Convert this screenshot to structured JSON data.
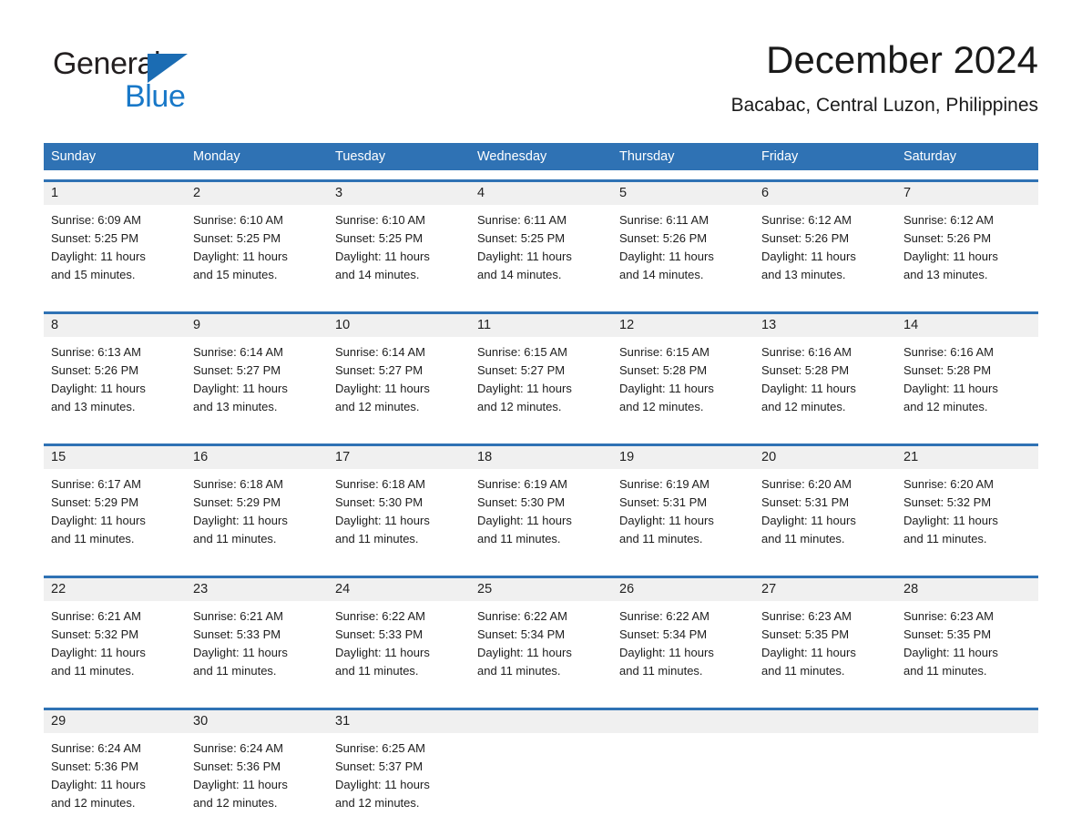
{
  "brand": {
    "word1": "General",
    "word2": "Blue",
    "triangle_icon": "triangle-logo-icon",
    "blue": "#1878c8",
    "dark_blue": "#1b6cb3"
  },
  "header": {
    "title": "December 2024",
    "location": "Bacabac, Central Luzon, Philippines"
  },
  "theme": {
    "header_band": "#2f72b4",
    "daynum_band": "#f0f0f0",
    "text": "#1d1d1d"
  },
  "weekdays": [
    "Sunday",
    "Monday",
    "Tuesday",
    "Wednesday",
    "Thursday",
    "Friday",
    "Saturday"
  ],
  "labels": {
    "sunrise_prefix": "Sunrise:",
    "sunset_prefix": "Sunset:",
    "daylight_prefix": "Daylight:"
  },
  "weeks": [
    {
      "days": [
        {
          "num": "1",
          "l1": "Sunrise: 6:09 AM",
          "l2": "Sunset: 5:25 PM",
          "l3": "Daylight: 11 hours",
          "l4": "and 15 minutes."
        },
        {
          "num": "2",
          "l1": "Sunrise: 6:10 AM",
          "l2": "Sunset: 5:25 PM",
          "l3": "Daylight: 11 hours",
          "l4": "and 15 minutes."
        },
        {
          "num": "3",
          "l1": "Sunrise: 6:10 AM",
          "l2": "Sunset: 5:25 PM",
          "l3": "Daylight: 11 hours",
          "l4": "and 14 minutes."
        },
        {
          "num": "4",
          "l1": "Sunrise: 6:11 AM",
          "l2": "Sunset: 5:25 PM",
          "l3": "Daylight: 11 hours",
          "l4": "and 14 minutes."
        },
        {
          "num": "5",
          "l1": "Sunrise: 6:11 AM",
          "l2": "Sunset: 5:26 PM",
          "l3": "Daylight: 11 hours",
          "l4": "and 14 minutes."
        },
        {
          "num": "6",
          "l1": "Sunrise: 6:12 AM",
          "l2": "Sunset: 5:26 PM",
          "l3": "Daylight: 11 hours",
          "l4": "and 13 minutes."
        },
        {
          "num": "7",
          "l1": "Sunrise: 6:12 AM",
          "l2": "Sunset: 5:26 PM",
          "l3": "Daylight: 11 hours",
          "l4": "and 13 minutes."
        }
      ]
    },
    {
      "days": [
        {
          "num": "8",
          "l1": "Sunrise: 6:13 AM",
          "l2": "Sunset: 5:26 PM",
          "l3": "Daylight: 11 hours",
          "l4": "and 13 minutes."
        },
        {
          "num": "9",
          "l1": "Sunrise: 6:14 AM",
          "l2": "Sunset: 5:27 PM",
          "l3": "Daylight: 11 hours",
          "l4": "and 13 minutes."
        },
        {
          "num": "10",
          "l1": "Sunrise: 6:14 AM",
          "l2": "Sunset: 5:27 PM",
          "l3": "Daylight: 11 hours",
          "l4": "and 12 minutes."
        },
        {
          "num": "11",
          "l1": "Sunrise: 6:15 AM",
          "l2": "Sunset: 5:27 PM",
          "l3": "Daylight: 11 hours",
          "l4": "and 12 minutes."
        },
        {
          "num": "12",
          "l1": "Sunrise: 6:15 AM",
          "l2": "Sunset: 5:28 PM",
          "l3": "Daylight: 11 hours",
          "l4": "and 12 minutes."
        },
        {
          "num": "13",
          "l1": "Sunrise: 6:16 AM",
          "l2": "Sunset: 5:28 PM",
          "l3": "Daylight: 11 hours",
          "l4": "and 12 minutes."
        },
        {
          "num": "14",
          "l1": "Sunrise: 6:16 AM",
          "l2": "Sunset: 5:28 PM",
          "l3": "Daylight: 11 hours",
          "l4": "and 12 minutes."
        }
      ]
    },
    {
      "days": [
        {
          "num": "15",
          "l1": "Sunrise: 6:17 AM",
          "l2": "Sunset: 5:29 PM",
          "l3": "Daylight: 11 hours",
          "l4": "and 11 minutes."
        },
        {
          "num": "16",
          "l1": "Sunrise: 6:18 AM",
          "l2": "Sunset: 5:29 PM",
          "l3": "Daylight: 11 hours",
          "l4": "and 11 minutes."
        },
        {
          "num": "17",
          "l1": "Sunrise: 6:18 AM",
          "l2": "Sunset: 5:30 PM",
          "l3": "Daylight: 11 hours",
          "l4": "and 11 minutes."
        },
        {
          "num": "18",
          "l1": "Sunrise: 6:19 AM",
          "l2": "Sunset: 5:30 PM",
          "l3": "Daylight: 11 hours",
          "l4": "and 11 minutes."
        },
        {
          "num": "19",
          "l1": "Sunrise: 6:19 AM",
          "l2": "Sunset: 5:31 PM",
          "l3": "Daylight: 11 hours",
          "l4": "and 11 minutes."
        },
        {
          "num": "20",
          "l1": "Sunrise: 6:20 AM",
          "l2": "Sunset: 5:31 PM",
          "l3": "Daylight: 11 hours",
          "l4": "and 11 minutes."
        },
        {
          "num": "21",
          "l1": "Sunrise: 6:20 AM",
          "l2": "Sunset: 5:32 PM",
          "l3": "Daylight: 11 hours",
          "l4": "and 11 minutes."
        }
      ]
    },
    {
      "days": [
        {
          "num": "22",
          "l1": "Sunrise: 6:21 AM",
          "l2": "Sunset: 5:32 PM",
          "l3": "Daylight: 11 hours",
          "l4": "and 11 minutes."
        },
        {
          "num": "23",
          "l1": "Sunrise: 6:21 AM",
          "l2": "Sunset: 5:33 PM",
          "l3": "Daylight: 11 hours",
          "l4": "and 11 minutes."
        },
        {
          "num": "24",
          "l1": "Sunrise: 6:22 AM",
          "l2": "Sunset: 5:33 PM",
          "l3": "Daylight: 11 hours",
          "l4": "and 11 minutes."
        },
        {
          "num": "25",
          "l1": "Sunrise: 6:22 AM",
          "l2": "Sunset: 5:34 PM",
          "l3": "Daylight: 11 hours",
          "l4": "and 11 minutes."
        },
        {
          "num": "26",
          "l1": "Sunrise: 6:22 AM",
          "l2": "Sunset: 5:34 PM",
          "l3": "Daylight: 11 hours",
          "l4": "and 11 minutes."
        },
        {
          "num": "27",
          "l1": "Sunrise: 6:23 AM",
          "l2": "Sunset: 5:35 PM",
          "l3": "Daylight: 11 hours",
          "l4": "and 11 minutes."
        },
        {
          "num": "28",
          "l1": "Sunrise: 6:23 AM",
          "l2": "Sunset: 5:35 PM",
          "l3": "Daylight: 11 hours",
          "l4": "and 11 minutes."
        }
      ]
    },
    {
      "days": [
        {
          "num": "29",
          "l1": "Sunrise: 6:24 AM",
          "l2": "Sunset: 5:36 PM",
          "l3": "Daylight: 11 hours",
          "l4": "and 12 minutes."
        },
        {
          "num": "30",
          "l1": "Sunrise: 6:24 AM",
          "l2": "Sunset: 5:36 PM",
          "l3": "Daylight: 11 hours",
          "l4": "and 12 minutes."
        },
        {
          "num": "31",
          "l1": "Sunrise: 6:25 AM",
          "l2": "Sunset: 5:37 PM",
          "l3": "Daylight: 11 hours",
          "l4": "and 12 minutes."
        },
        {
          "num": "",
          "l1": "",
          "l2": "",
          "l3": "",
          "l4": ""
        },
        {
          "num": "",
          "l1": "",
          "l2": "",
          "l3": "",
          "l4": ""
        },
        {
          "num": "",
          "l1": "",
          "l2": "",
          "l3": "",
          "l4": ""
        },
        {
          "num": "",
          "l1": "",
          "l2": "",
          "l3": "",
          "l4": ""
        }
      ]
    }
  ]
}
